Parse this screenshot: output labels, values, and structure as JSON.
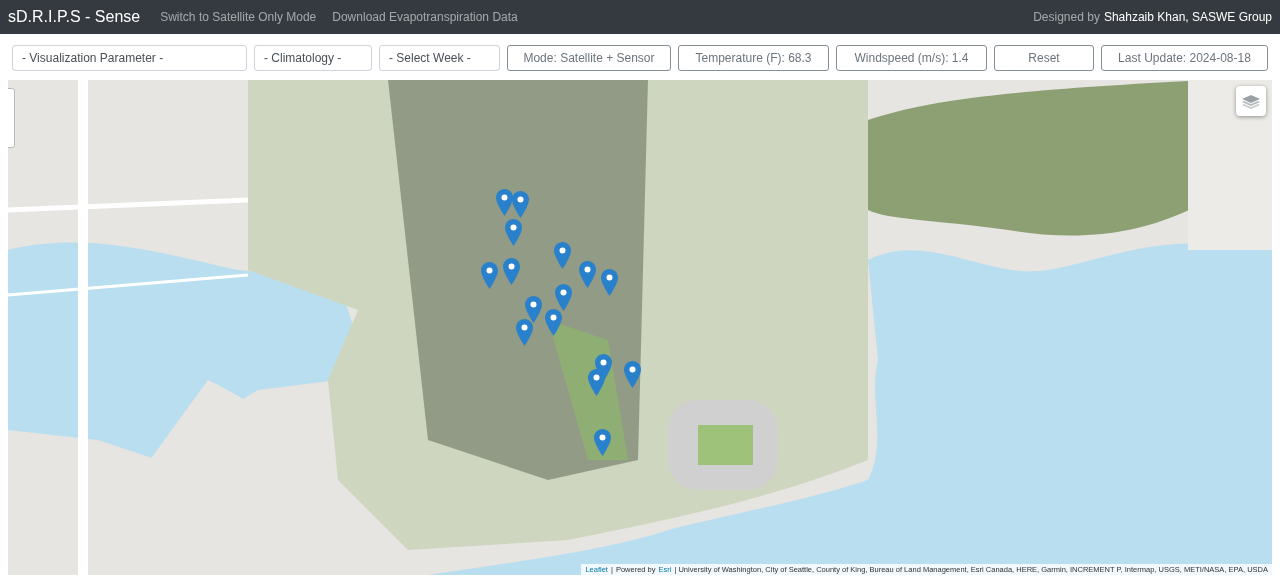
{
  "navbar": {
    "brand": "sD.R.I.P.S - Sense",
    "links": [
      "Switch to Satellite Only Mode",
      "Download Evapotranspiration Data"
    ],
    "credit": {
      "prefix": "Designed by",
      "author": "Shahzaib Khan, SASWE Group"
    }
  },
  "controls": [
    {
      "kind": "select",
      "label": "- Visualization Parameter -"
    },
    {
      "kind": "select",
      "label": "- Climatology -"
    },
    {
      "kind": "select",
      "label": "- Select Week -"
    },
    {
      "kind": "button",
      "label": "Mode: Satellite + Sensor"
    },
    {
      "kind": "button",
      "label": "Temperature (F): 68.3"
    },
    {
      "kind": "button",
      "label": "Windspeed (m/s): 1.4"
    },
    {
      "kind": "button",
      "label": "Reset"
    },
    {
      "kind": "button",
      "label": "Last Update: 2024-08-18"
    }
  ],
  "map": {
    "attribution": {
      "leaflet": "Leaflet",
      "separator": "|",
      "powered_by": "Powered by",
      "esri": "Esri",
      "sources": "| University of Washington, City of Seattle, County of King, Bureau of Land Management, Esri Canada, HERE, Garmin, INCREMENT P, Intermap, USGS, METI/NASA, EPA, USDA"
    }
  }
}
